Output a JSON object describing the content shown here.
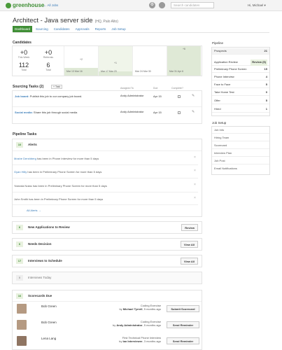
{
  "app": {
    "logo_text": "greenhouse",
    "all_jobs": "← All Jobs",
    "search_placeholder": "Search candidates",
    "user_menu": "Hi, Michael ▾",
    "icons": [
      "gear-icon",
      "person-icon",
      "help-icon"
    ]
  },
  "job": {
    "title": "Architect - Java server side",
    "location": "(HQ, Palo Alto)"
  },
  "tabs": [
    {
      "label": "Dashboard",
      "active": true
    },
    {
      "label": "Sourcing",
      "active": false
    },
    {
      "label": "Candidates",
      "active": false
    },
    {
      "label": "Approvals",
      "active": false
    },
    {
      "label": "Reports",
      "active": false
    },
    {
      "label": "Job Setup",
      "active": false
    }
  ],
  "candidates": {
    "heading": "Candidates",
    "this_week": {
      "value": "+0",
      "label": "This Week"
    },
    "referrals": {
      "value": "+0",
      "label": "Referrals"
    },
    "total": {
      "value": "112",
      "label": "Total"
    },
    "referral_total": {
      "value": "6",
      "label": "Total"
    }
  },
  "chart_data": {
    "type": "bar",
    "categories": [
      "Mar 13 Mar 16",
      "Mar 17 Mar 23",
      "Mar 24 Mar 30",
      "Mar 31 Apr 6"
    ],
    "values": [
      2,
      1,
      0,
      6
    ],
    "value_labels": [
      "+2",
      "+1",
      "",
      "+6"
    ],
    "highlighted": [
      1,
      3
    ]
  },
  "sourcing_tasks": {
    "heading": "Sourcing Tasks (2)",
    "add_label": "+ Task",
    "columns": [
      "Assigned To",
      "Due",
      "Complete?"
    ],
    "rows": [
      {
        "kind": "Job board:",
        "text": "Publish this job to our company job board.",
        "assigned": "Andy Administrator",
        "due": "Apr 15"
      },
      {
        "kind": "Social media:",
        "text": "Share this job through social media",
        "assigned": "Andy Administrator",
        "due": "Apr 15"
      }
    ]
  },
  "pipeline_tasks": {
    "heading": "Pipeline Tasks",
    "alerts": {
      "count": "10",
      "title": "Alerts",
      "rows": [
        {
          "name": "Moshe Dershberg",
          "text": "has been in Phone Interview for more than 5 days"
        },
        {
          "name": "Gyan Hilly",
          "text": "has been in Preliminary Phone Screen for more than 5 days"
        },
        {
          "name": "Yolanda Nolas",
          "text": "has been in Preliminary Phone Screen for more than 5 days"
        },
        {
          "name": "John Smith",
          "text": "has been in Preliminary Phone Screen for more than 5 days"
        }
      ],
      "all_link": "All Alerts →"
    },
    "groups": [
      {
        "count": "6",
        "title": "New Applications to Review",
        "button": "Review"
      },
      {
        "count": "6",
        "title": "Needs Decision",
        "button": "View All"
      },
      {
        "count": "17",
        "title": "Interviews to Schedule",
        "button": "View All"
      },
      {
        "count": "0",
        "title": "Interviews Today",
        "button": ""
      }
    ],
    "scorecards": {
      "count": "16",
      "title": "Scorecards Due",
      "rows": [
        {
          "name": "Bob Green",
          "stage": "Coding Exercise",
          "by": "Michael Tyrrell",
          "ago": "5 months ago",
          "button": "Submit Scorecard"
        },
        {
          "name": "Bob Green",
          "stage": "Coding Exercise",
          "by": "Andy Administrator",
          "ago": "5 months ago",
          "button": "Send Reminder"
        },
        {
          "name": "Lena Lang",
          "stage": "First Technical Phone Interview",
          "by": "Ian Interviewer",
          "ago": "3 months ago",
          "button": "Send Reminder"
        }
      ]
    }
  },
  "pipeline_sidebar": {
    "heading": "Pipeline",
    "stages": [
      {
        "label": "Prospects",
        "value": "21",
        "highlight": true
      },
      {
        "label": "Application Review",
        "value": "Review (5)",
        "highlight": false
      },
      {
        "label": "Preliminary Phone Screen",
        "value": "15",
        "highlight": false
      },
      {
        "label": "Phone Interview",
        "value": "4",
        "highlight": false
      },
      {
        "label": "Face to Face",
        "value": "5",
        "highlight": false
      },
      {
        "label": "Take Home Test",
        "value": "0",
        "highlight": false
      },
      {
        "label": "Offer",
        "value": "5",
        "highlight": false
      },
      {
        "label": "Hired",
        "value": "1",
        "highlight": false
      }
    ]
  },
  "job_setup": {
    "heading": "Job Setup",
    "links": [
      "Job Info",
      "Hiring Team",
      "Scorecard",
      "Interview Plan",
      "Job Post",
      "Email Notifications"
    ]
  }
}
